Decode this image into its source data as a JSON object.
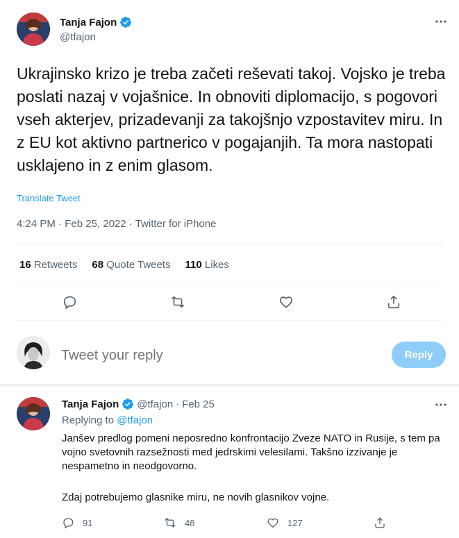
{
  "main_tweet": {
    "author_name": "Tanja Fajon",
    "handle": "@tfajon",
    "text": "Ukrajinsko krizo je treba začeti reševati takoj. Vojsko je treba poslati nazaj v vojašnice. In obnoviti diplomacijo, s pogovori vseh akterjev, prizadevanji za takojšnjo vzpostavitev miru. In z EU kot aktivno partnerico v pogajanjih. Ta mora nastopati usklajeno in z enim glasom.",
    "translate_label": "Translate Tweet",
    "time": "4:24 PM",
    "date": "Feb 25, 2022",
    "source": "Twitter for iPhone",
    "separator": "·",
    "stats": {
      "retweets_count": "16",
      "retweets_label": "Retweets",
      "quotes_count": "68",
      "quotes_label": "Quote Tweets",
      "likes_count": "110",
      "likes_label": "Likes"
    }
  },
  "reply_box": {
    "placeholder": "Tweet your reply",
    "button_label": "Reply"
  },
  "reply_tweet": {
    "author_name": "Tanja Fajon",
    "handle": "@tfajon",
    "separator": "·",
    "date": "Feb 25",
    "replying_prefix": "Replying to",
    "replying_handle": "@tfajon",
    "paragraph1": "Janšev predlog pomeni neposredno konfrontacijo Zveze NATO in Rusije, s tem pa vojno svetovnih razsežnosti med jedrskimi velesilami. Takšno izzivanje je nespametno in neodgovorno.",
    "paragraph2": "Zdaj potrebujemo glasnike miru, ne novih glasnikov vojne.",
    "reply_count": "91",
    "retweet_count": "48",
    "like_count": "127"
  },
  "colors": {
    "accent": "#1d9bf0",
    "muted": "#536471",
    "reply_button": "#8ecdf8",
    "divider": "#eff3f4"
  }
}
